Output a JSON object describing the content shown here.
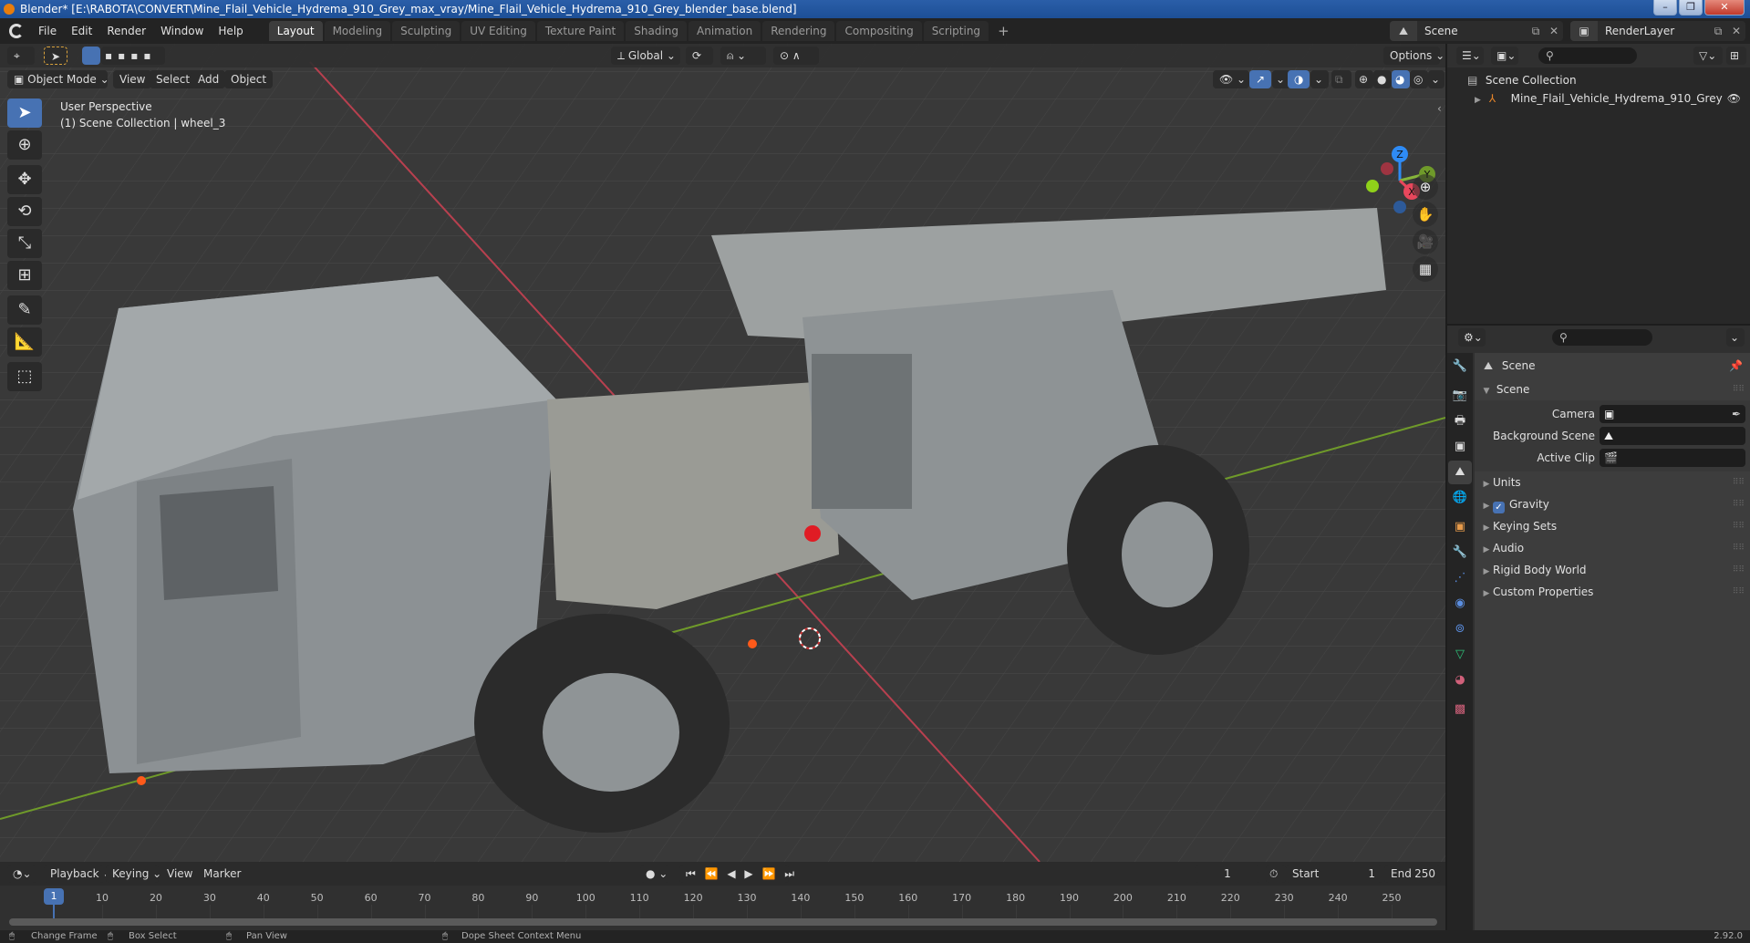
{
  "window": {
    "title": "Blender* [E:\\RABOTA\\CONVERT\\Mine_Flail_Vehicle_Hydrema_910_Grey_max_vray/Mine_Flail_Vehicle_Hydrema_910_Grey_blender_base.blend]",
    "controls": {
      "minimize": "–",
      "maximize": "❐",
      "close": "✕"
    }
  },
  "menu": [
    "File",
    "Edit",
    "Render",
    "Window",
    "Help"
  ],
  "workspaces": [
    {
      "label": "Layout",
      "active": true
    },
    {
      "label": "Modeling"
    },
    {
      "label": "Sculpting"
    },
    {
      "label": "UV Editing"
    },
    {
      "label": "Texture Paint"
    },
    {
      "label": "Shading"
    },
    {
      "label": "Animation"
    },
    {
      "label": "Rendering"
    },
    {
      "label": "Compositing"
    },
    {
      "label": "Scripting"
    }
  ],
  "add_workspace": "+",
  "scene_selector": {
    "value": "Scene"
  },
  "view_layer_selector": {
    "value": "RenderLayer"
  },
  "viewport": {
    "transform_orientation": "Global",
    "options_label": "Options",
    "mode": "Object Mode",
    "header_menus": [
      "View",
      "Select",
      "Add",
      "Object"
    ],
    "info_line1": "User Perspective",
    "info_line2": "(1) Scene Collection | wheel_3",
    "gizmo_axes": {
      "x": "X",
      "y": "Y",
      "z": "Z"
    },
    "colors": {
      "x_axis": "#e8475c",
      "y_axis": "#86b53a",
      "z_axis": "#2e8bf5",
      "background": "#393939",
      "grid": "#4a4a4a",
      "model": "#8f9598",
      "active_blue": "#4772b3"
    },
    "shading_mode": "solid"
  },
  "outliner": {
    "root": "Scene Collection",
    "items": [
      {
        "label": "Mine_Flail_Vehicle_Hydrema_910_Grey",
        "visible": true
      }
    ]
  },
  "properties": {
    "context_title": "Scene",
    "panel_title": "Scene",
    "fields": [
      {
        "label": "Camera",
        "value": ""
      },
      {
        "label": "Background Scene",
        "value": ""
      },
      {
        "label": "Active Clip",
        "value": ""
      }
    ],
    "subpanels": [
      {
        "label": "Units"
      },
      {
        "label": "Gravity",
        "checkbox": true,
        "checked": true
      },
      {
        "label": "Keying Sets"
      },
      {
        "label": "Audio"
      },
      {
        "label": "Rigid Body World"
      },
      {
        "label": "Custom Properties"
      }
    ]
  },
  "timeline": {
    "menus": [
      "Playback",
      "Keying",
      "View",
      "Marker"
    ],
    "current_frame": "1",
    "start_label": "Start",
    "start": "1",
    "end_label": "End",
    "end": "250",
    "ticks": [
      "1",
      "10",
      "20",
      "30",
      "40",
      "50",
      "60",
      "70",
      "80",
      "90",
      "100",
      "110",
      "120",
      "130",
      "140",
      "150",
      "160",
      "170",
      "180",
      "190",
      "200",
      "210",
      "220",
      "230",
      "240",
      "250"
    ]
  },
  "statusbar": {
    "hints": [
      "Change Frame",
      "Box Select",
      "Pan View",
      "Dope Sheet Context Menu"
    ],
    "version": "2.92.0"
  }
}
